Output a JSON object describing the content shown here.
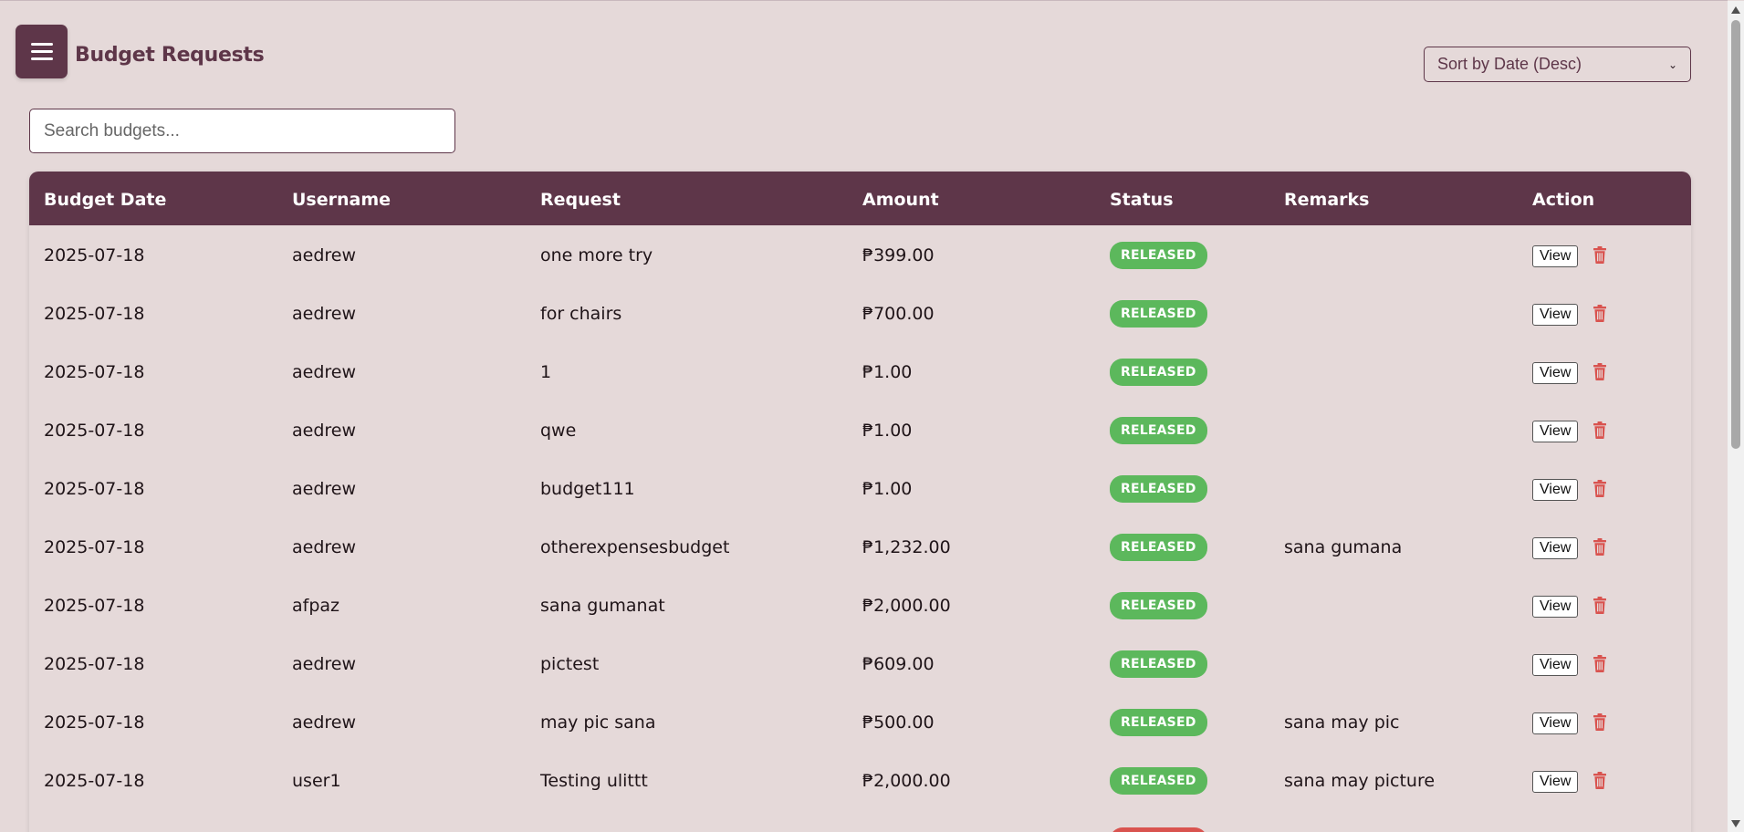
{
  "header": {
    "title": "Budget Requests",
    "menu_icon": "hamburger-menu-icon"
  },
  "sort": {
    "selected": "Sort by Date (Desc)"
  },
  "search": {
    "placeholder": "Search budgets..."
  },
  "table": {
    "columns": {
      "date": "Budget Date",
      "username": "Username",
      "request": "Request",
      "amount": "Amount",
      "status": "Status",
      "remarks": "Remarks",
      "action": "Action"
    },
    "view_label": "View",
    "rows": [
      {
        "date": "2025-07-18",
        "username": "aedrew",
        "request": "one more try",
        "amount": "₱399.00",
        "status": "RELEASED",
        "remarks": ""
      },
      {
        "date": "2025-07-18",
        "username": "aedrew",
        "request": "for chairs",
        "amount": "₱700.00",
        "status": "RELEASED",
        "remarks": ""
      },
      {
        "date": "2025-07-18",
        "username": "aedrew",
        "request": "1",
        "amount": "₱1.00",
        "status": "RELEASED",
        "remarks": ""
      },
      {
        "date": "2025-07-18",
        "username": "aedrew",
        "request": "qwe",
        "amount": "₱1.00",
        "status": "RELEASED",
        "remarks": ""
      },
      {
        "date": "2025-07-18",
        "username": "aedrew",
        "request": "budget111",
        "amount": "₱1.00",
        "status": "RELEASED",
        "remarks": ""
      },
      {
        "date": "2025-07-18",
        "username": "aedrew",
        "request": "otherexpensesbudget",
        "amount": "₱1,232.00",
        "status": "RELEASED",
        "remarks": "sana gumana"
      },
      {
        "date": "2025-07-18",
        "username": "afpaz",
        "request": "sana gumanat",
        "amount": "₱2,000.00",
        "status": "RELEASED",
        "remarks": ""
      },
      {
        "date": "2025-07-18",
        "username": "aedrew",
        "request": "pictest",
        "amount": "₱609.00",
        "status": "RELEASED",
        "remarks": ""
      },
      {
        "date": "2025-07-18",
        "username": "aedrew",
        "request": "may pic sana",
        "amount": "₱500.00",
        "status": "RELEASED",
        "remarks": "sana may pic"
      },
      {
        "date": "2025-07-18",
        "username": "user1",
        "request": "Testing ulittt",
        "amount": "₱2,000.00",
        "status": "RELEASED",
        "remarks": "sana may picture"
      }
    ]
  },
  "colors": {
    "primary": "#5e3649",
    "background": "#e5d9d9",
    "released": "#5cb85c",
    "rejected": "#d9534f",
    "trash": "#d9534f"
  }
}
